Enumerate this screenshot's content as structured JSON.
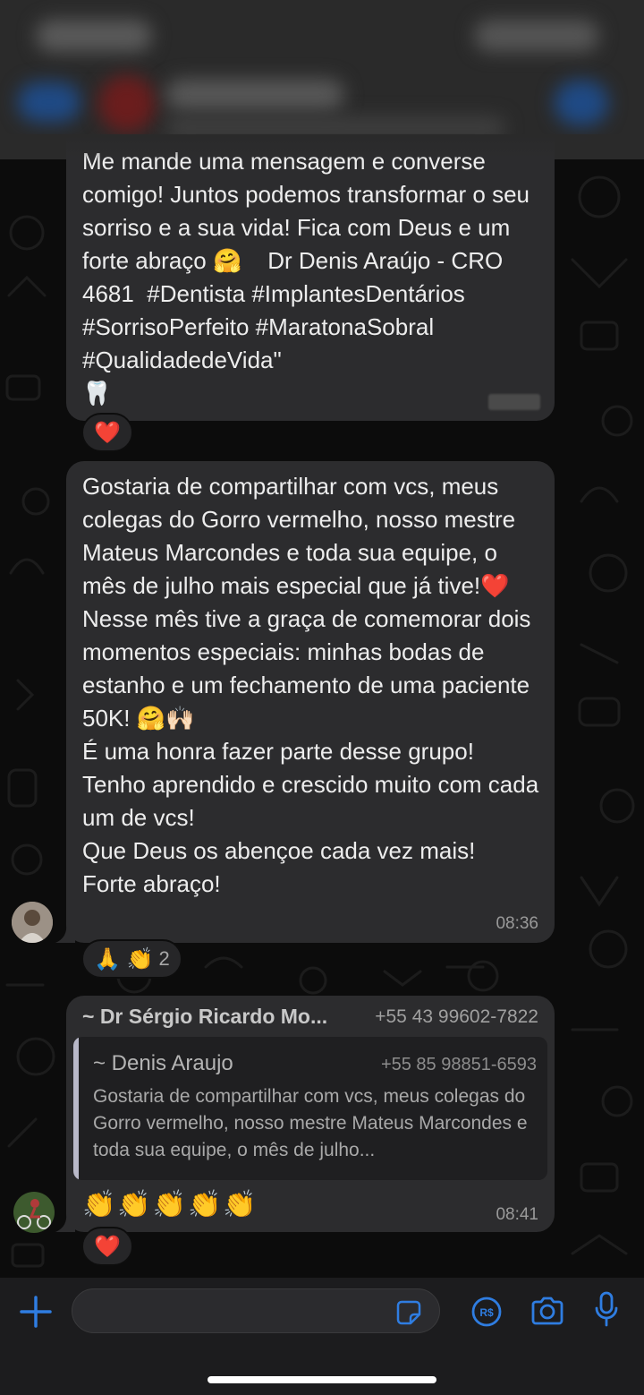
{
  "messages": {
    "first": {
      "text": "Me mande uma mensagem e converse comigo! Juntos podemos transformar o seu sorriso e a sua vida! Fica com Deus e um forte abraço 🤗    Dr Denis Araújo - CRO 4681  #Dentista #ImplantesDentários #SorrisoPerfeito #MaratonaSobral #QualidadedeVida\"\n🦷",
      "reaction": "❤️"
    },
    "second": {
      "text": "Gostaria de compartilhar com vcs, meus colegas do Gorro vermelho, nosso mestre Mateus Marcondes e toda sua equipe, o mês de julho mais especial que já tive!❤️\nNesse mês tive a graça de comemorar dois momentos especiais: minhas bodas de estanho e um fechamento de uma paciente 50K! 🤗🙌🏻\nÉ uma honra fazer parte desse grupo!\nTenho aprendido e crescido muito com cada um de vcs!\nQue Deus os abençoe cada vez mais!\nForte abraço!",
      "time": "08:36",
      "reactions": "🙏 👏",
      "reaction_count": "2"
    },
    "third": {
      "sender": "~ Dr Sérgio Ricardo Mo...",
      "phone": "+55 43 99602-7822",
      "quoted_name": "~ Denis Araujo",
      "quoted_phone": "+55 85 98851-6593",
      "quoted_text": "Gostaria de compartilhar com vcs, meus colegas do Gorro vermelho, nosso mestre Mateus Marcondes e toda sua equipe, o mês de julho...",
      "text": "👏👏👏👏👏",
      "time": "08:41",
      "reaction": "❤️"
    }
  },
  "composer": {
    "placeholder": ""
  },
  "colors": {
    "accent": "#2f7de1",
    "bubble": "#2c2c2e",
    "background": "#0c0c0c"
  }
}
